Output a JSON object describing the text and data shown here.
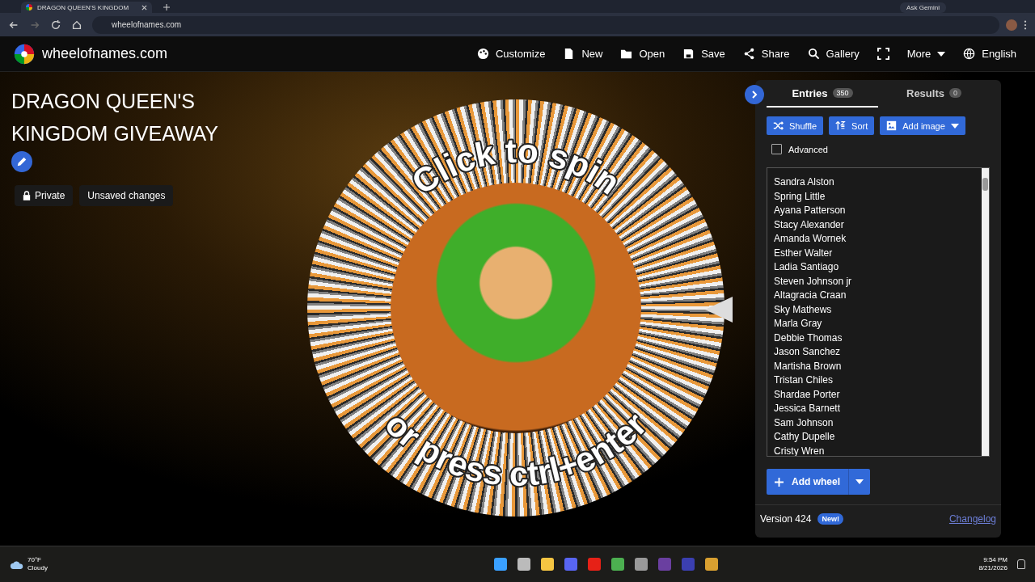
{
  "browser": {
    "tab_title": "DRAGON QUEEN'S KINGDOM",
    "url": "wheelofnames.com",
    "ask_gemini": "Ask Gemini"
  },
  "nav": {
    "site_name": "wheelofnames.com",
    "items": [
      {
        "kind": "palette",
        "label": "Customize"
      },
      {
        "kind": "file",
        "label": "New"
      },
      {
        "kind": "folder",
        "label": "Open"
      },
      {
        "kind": "save",
        "label": "Save"
      },
      {
        "kind": "share",
        "label": "Share"
      },
      {
        "kind": "search",
        "label": "Gallery"
      },
      {
        "kind": "fullscreen"
      },
      {
        "kind": "more",
        "label": "More"
      },
      {
        "kind": "globe",
        "label": "English"
      }
    ]
  },
  "title": "DRAGON QUEEN'S KINGDOM GIVEAWAY",
  "tags": [
    "Private",
    "Unsaved changes"
  ],
  "wheel": {
    "top_text": "Click to spin",
    "bottom_text": "or press ctrl+enter"
  },
  "panel": {
    "tabs": [
      {
        "label": "Entries",
        "count": "350",
        "selected": true
      },
      {
        "label": "Results",
        "count": "0",
        "selected": false
      }
    ],
    "buttons": [
      {
        "kind": "shuffle",
        "label": "Shuffle"
      },
      {
        "kind": "sort",
        "label": "Sort"
      },
      {
        "kind": "image",
        "label": "Add image"
      }
    ],
    "advanced": {
      "label": "Advanced",
      "checked": false
    },
    "entries": [
      "Sandra Alston",
      "Spring Little",
      "Ayana Patterson",
      "Stacy Alexander",
      "Amanda Wornek",
      "Esther Walter",
      "Ladia Santiago",
      "Steven Johnson jr",
      "Altagracia Craan",
      "Sky Mathews",
      "Marla Gray",
      "Debbie Thomas",
      "Jason Sanchez",
      "Martisha Brown",
      "Tristan Chiles",
      "Shardae Porter",
      "Jessica Barnett",
      "Sam Johnson",
      "Cathy Dupelle",
      "Cristy Wren"
    ],
    "add_wheel": "Add wheel",
    "version": "Version 424",
    "new_badge": "New!",
    "changelog": "Changelog"
  },
  "taskbar": {
    "temperature": "70°F",
    "weather": "Cloudy",
    "time": "9:54 PM",
    "date": "8/21/2026"
  }
}
